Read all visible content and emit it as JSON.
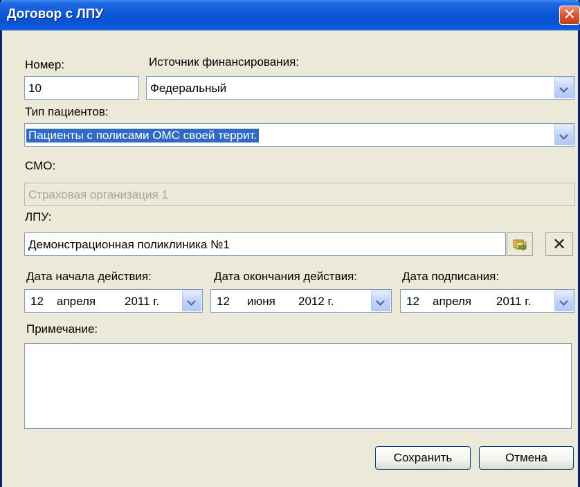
{
  "window": {
    "title": "Договор с ЛПУ",
    "close_label": "✕"
  },
  "form": {
    "number_label": "Номер:",
    "number_value": "10",
    "funding_label": "Источник финансирования:",
    "funding_value": "Федеральный",
    "patient_type_label": "Тип пациентов:",
    "patient_type_value": "Пациенты с полисами ОМС своей террит.",
    "smo_label": "СМО:",
    "smo_value": "Страховая организация 1",
    "lpu_label": "ЛПУ:",
    "lpu_value": "Демонстрационная поликлиника №1",
    "start_date_label": "Дата начала действия:",
    "start_date": {
      "day": "12",
      "month": "апреля",
      "year": "2011 г."
    },
    "end_date_label": "Дата окончания действия:",
    "end_date": {
      "day": "12",
      "month": "июня",
      "year": "2012 г."
    },
    "sign_date_label": "Дата подписания:",
    "sign_date": {
      "day": "12",
      "month": "апреля",
      "year": "2011 г."
    },
    "notes_label": "Примечание:",
    "notes_value": ""
  },
  "buttons": {
    "save": "Сохранить",
    "cancel": "Отмена",
    "clear_glyph": "✕"
  },
  "colors": {
    "titlebar": "#0A52CF",
    "selection": "#316AC5",
    "dialog_bg": "#ECE9D8"
  }
}
